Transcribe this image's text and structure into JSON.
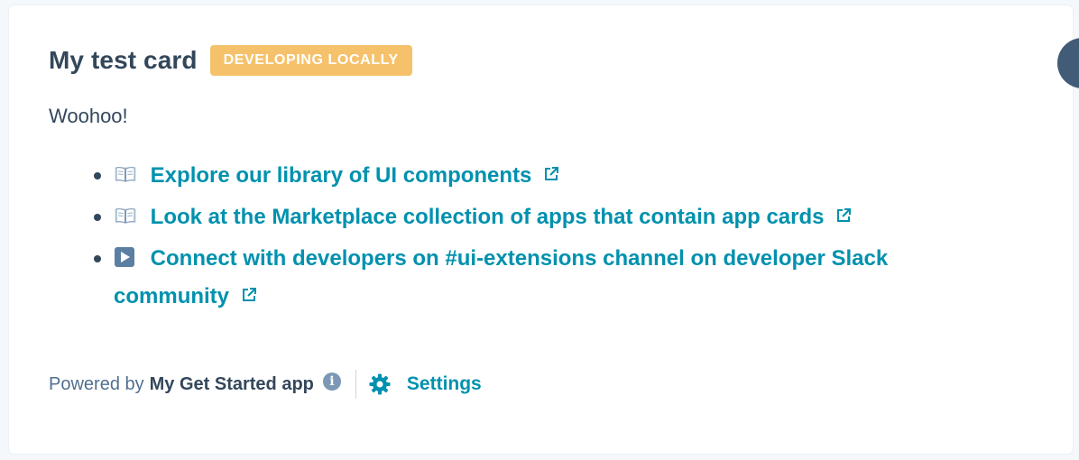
{
  "card": {
    "title": "My test card",
    "badge": "DEVELOPING LOCALLY",
    "body_text": "Woohoo!"
  },
  "links": [
    {
      "emoji_icon": "open-book-icon",
      "label": "Explore our library of UI components"
    },
    {
      "emoji_icon": "open-book-icon",
      "label": "Look at the Marketplace collection of apps that contain app cards"
    },
    {
      "emoji_icon": "play-button-icon",
      "label": "Connect with developers on #ui-extensions channel on developer Slack community"
    }
  ],
  "footer": {
    "powered_by_label": "Powered by",
    "app_name": "My Get Started app",
    "settings_label": "Settings"
  },
  "colors": {
    "badge": "#f5c26b",
    "link": "#0091ae",
    "text": "#33475b"
  }
}
